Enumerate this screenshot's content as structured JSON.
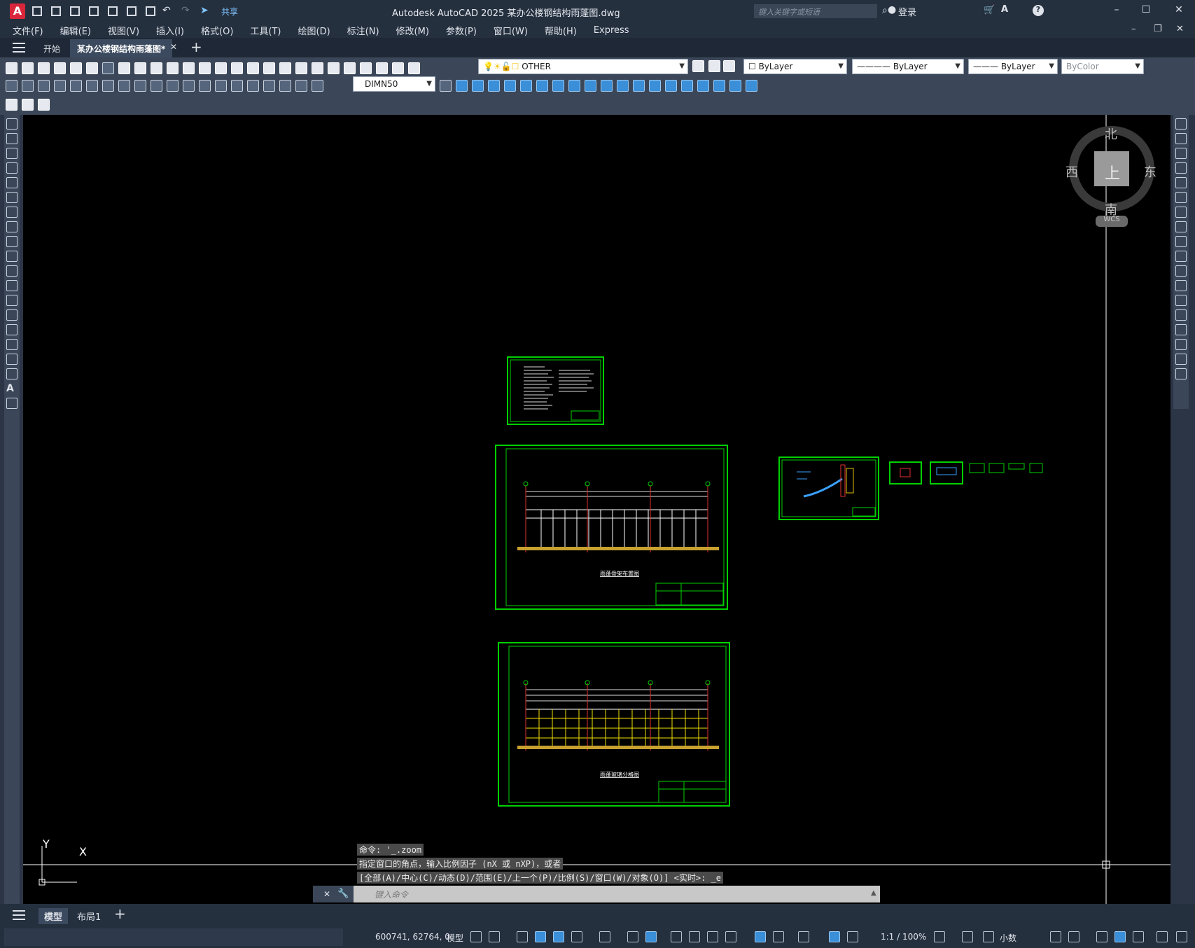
{
  "titlebar": {
    "logo": "A",
    "share": "共享",
    "app_title": "Autodesk AutoCAD 2025    某办公楼钢结构雨蓬图.dwg",
    "search_placeholder": "键入关键字或短语",
    "login": "登录"
  },
  "menu": [
    "文件(F)",
    "编辑(E)",
    "视图(V)",
    "插入(I)",
    "格式(O)",
    "工具(T)",
    "绘图(D)",
    "标注(N)",
    "修改(M)",
    "参数(P)",
    "窗口(W)",
    "帮助(H)",
    "Express"
  ],
  "tabs": {
    "start": "开始",
    "document": "某办公楼钢结构雨蓬图*"
  },
  "toolbar": {
    "layer": "OTHER",
    "color": "ByLayer",
    "linetype": "ByLayer",
    "lineweight": "ByLayer",
    "plotstyle": "ByColor",
    "dimstyle": "DIMN50"
  },
  "viewcube": {
    "north": "北",
    "south": "南",
    "east": "东",
    "west": "西",
    "face": "上",
    "wcs": "WCS"
  },
  "ucs": {
    "x": "X",
    "y": "Y"
  },
  "drawing": {
    "sheet2_title": "雨蓬骨架布置图",
    "sheet3_title": "雨蓬玻璃分格图"
  },
  "command": {
    "history": [
      "命令: '_.zoom",
      "指定窗口的角点，输入比例因子 (nX 或 nXP)，或者",
      "[全部(A)/中心(C)/动态(D)/范围(E)/上一个(P)/比例(S)/窗口(W)/对象(O)] <实时>: _e"
    ],
    "placeholder": "键入命令"
  },
  "layout_tabs": [
    "模型",
    "布局1"
  ],
  "status": {
    "coords": "600741, 62764, 0",
    "model": "模型",
    "scale": "1:1 / 100%",
    "units": "小数"
  }
}
